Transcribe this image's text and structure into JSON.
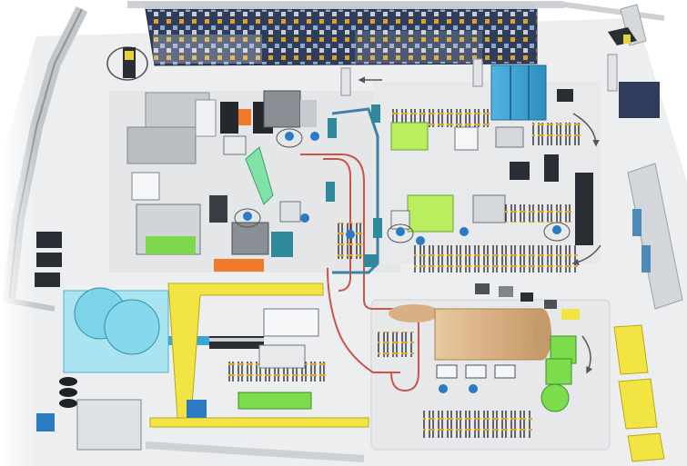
{
  "scene": {
    "kind": "isometric factory floor layout",
    "palette": {
      "floor": "#e4e6e8",
      "wall": "#c9ccd0",
      "wall_dark": "#8e949a",
      "rack": "#2f3c5c",
      "rack_accent": "#d8a326",
      "cyan": "#39a7d6",
      "teal": "#2e8a9a",
      "lime": "#b9ef5e",
      "green": "#7ddc4c",
      "mint": "#7fe3a8",
      "yellow": "#f2e443",
      "orange": "#f07a2a",
      "tan": "#d9b083",
      "pipe": "#c9554a",
      "dark": "#2a2d33",
      "gray": "#9da3aa"
    },
    "directional_arrows": 3
  }
}
